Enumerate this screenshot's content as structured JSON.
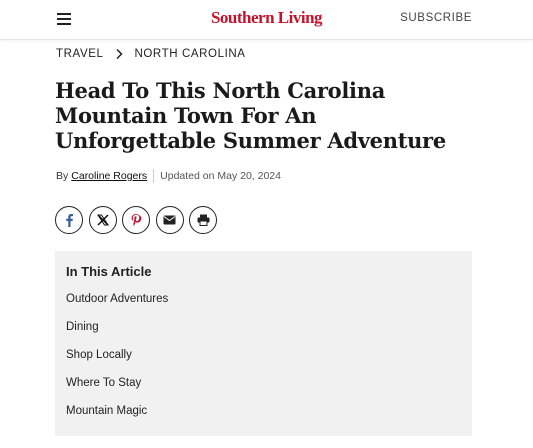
{
  "header": {
    "logo": "Southern Living",
    "subscribe_label": "SUBSCRIBE",
    "brand_color": "#c2152d"
  },
  "breadcrumb": {
    "items": [
      "TRAVEL",
      "NORTH CAROLINA"
    ]
  },
  "article": {
    "title": "Head To This North Carolina Mountain Town For An Unforgettable Summer Adventure",
    "byline_prefix": "By",
    "author": "Caroline Rogers",
    "updated": "Updated on May 20, 2024"
  },
  "share": {
    "icons": [
      "facebook-icon",
      "x-icon",
      "pinterest-icon",
      "email-icon",
      "print-icon"
    ]
  },
  "toc": {
    "title": "In This Article",
    "items": [
      "Outdoor Adventures",
      "Dining",
      "Shop Locally",
      "Where To Stay",
      "Mountain Magic"
    ]
  }
}
